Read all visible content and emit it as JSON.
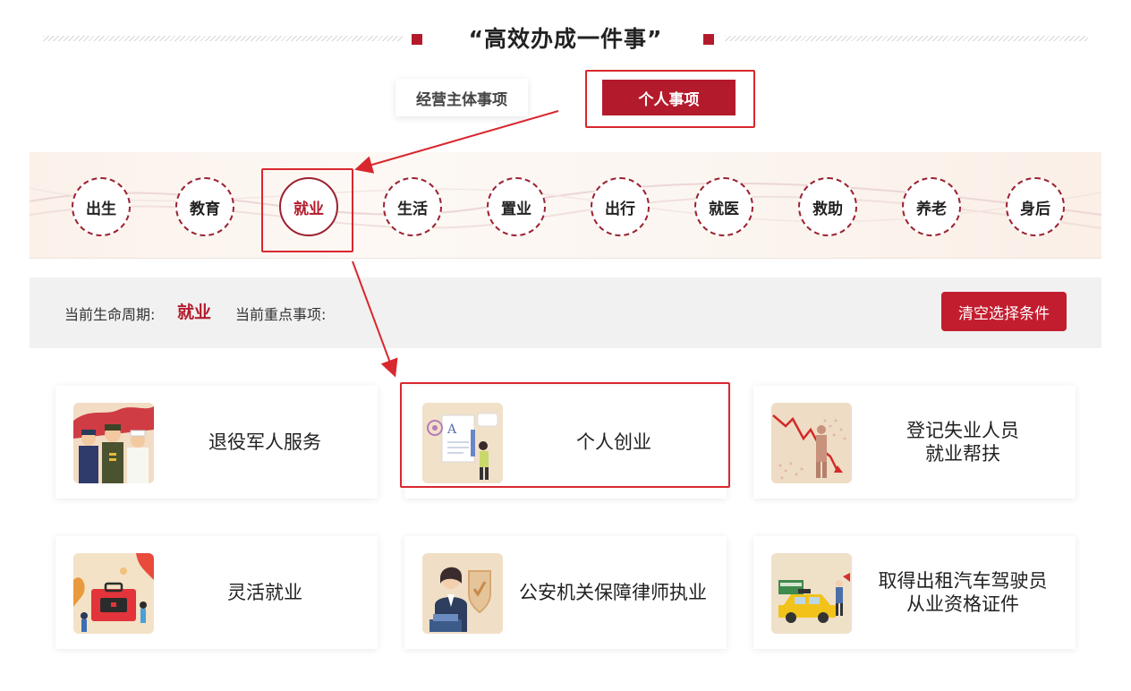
{
  "header": {
    "title": "“高效办成一件事”"
  },
  "tabs": {
    "business_label": "经营主体事项",
    "personal_label": "个人事项",
    "active": "personal"
  },
  "lifecycle": {
    "items": [
      {
        "label": "出生"
      },
      {
        "label": "教育"
      },
      {
        "label": "就业"
      },
      {
        "label": "生活"
      },
      {
        "label": "置业"
      },
      {
        "label": "出行"
      },
      {
        "label": "就医"
      },
      {
        "label": "救助"
      },
      {
        "label": "养老"
      },
      {
        "label": "身后"
      }
    ],
    "active": "就业"
  },
  "filter": {
    "period_label": "当前生命周期:",
    "period_value": "就业",
    "focus_label": "当前重点事项:",
    "clear_button": "清空选择条件"
  },
  "cards": [
    {
      "lines": [
        "退役军人服务"
      ],
      "icon": "veterans-image"
    },
    {
      "lines": [
        "个人创业"
      ],
      "icon": "entrepreneurship-image"
    },
    {
      "lines": [
        "登记失业人员",
        "就业帮扶"
      ],
      "icon": "unemployment-image"
    },
    {
      "lines": [
        "灵活就业"
      ],
      "icon": "flexible-work-image"
    },
    {
      "lines": [
        "公安机关保障律师执业"
      ],
      "icon": "lawyer-image"
    },
    {
      "lines": [
        "取得出租汽车驾驶员",
        "从业资格证件"
      ],
      "icon": "taxi-image"
    }
  ],
  "colors": {
    "accent": "#b31b2c",
    "highlight": "#d9272e",
    "filter_bg": "#f1f1f1"
  }
}
